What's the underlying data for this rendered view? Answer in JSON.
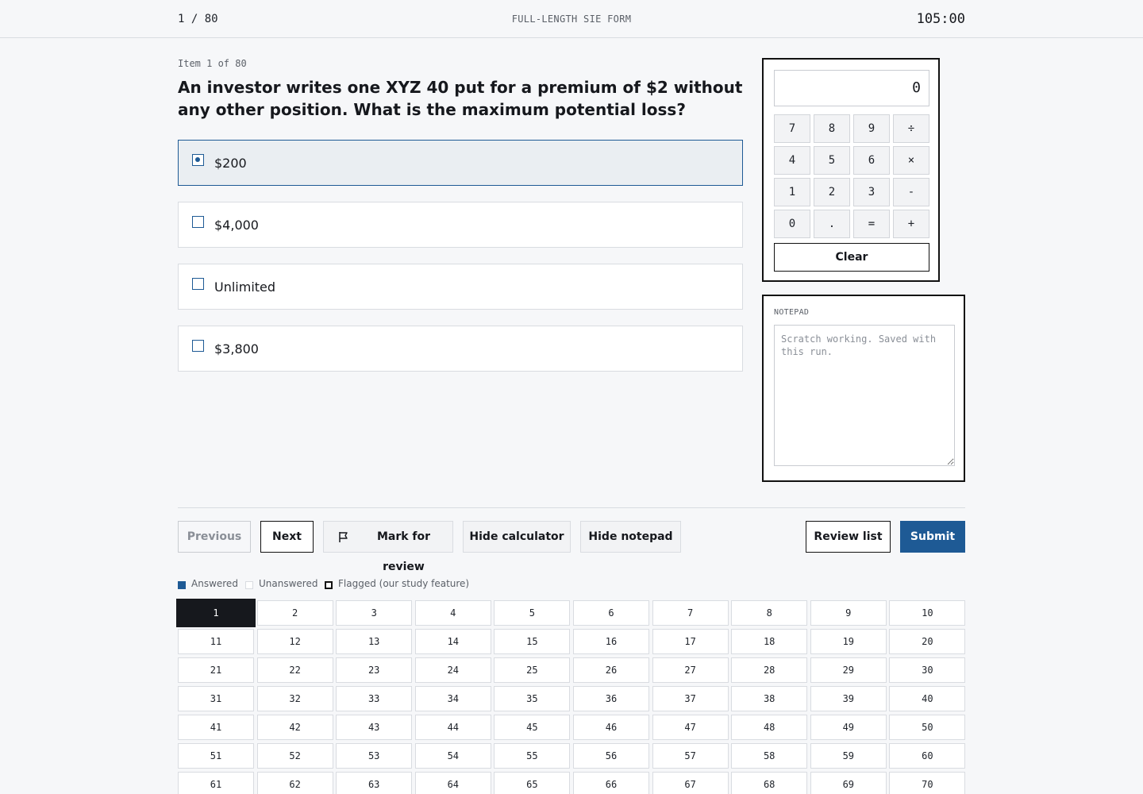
{
  "header": {
    "progress": "1 / 80",
    "form_title": "FULL-LENGTH SIE FORM",
    "timer": "105:00"
  },
  "question": {
    "item_label": "Item 1 of 80",
    "text": "An investor writes one XYZ 40 put for a premium of $2 without any other position. What is the maximum potential loss?",
    "options": [
      {
        "text": "$200",
        "selected": true
      },
      {
        "text": "$4,000",
        "selected": false
      },
      {
        "text": "Unlimited",
        "selected": false
      },
      {
        "text": "$3,800",
        "selected": false
      }
    ]
  },
  "calculator": {
    "display": "0",
    "keys": [
      "7",
      "8",
      "9",
      "÷",
      "4",
      "5",
      "6",
      "×",
      "1",
      "2",
      "3",
      "-",
      "0",
      ".",
      "=",
      "+"
    ],
    "clear_label": "Clear"
  },
  "notepad": {
    "label": "NOTEPAD",
    "placeholder": "Scratch working. Saved with this run.",
    "value": ""
  },
  "actions": {
    "previous": "Previous",
    "next": "Next",
    "mark_for_review": "Mark for review",
    "hide_calculator": "Hide calculator",
    "hide_notepad": "Hide notepad",
    "review_list": "Review list",
    "submit": "Submit"
  },
  "legend": {
    "answered": "Answered",
    "unanswered": "Unanswered",
    "flagged": "Flagged (our study feature)"
  },
  "navigator": {
    "current": 1,
    "visible_items": [
      "1",
      "2",
      "3",
      "4",
      "5",
      "6",
      "7",
      "8",
      "9",
      "10",
      "11",
      "12",
      "13",
      "14",
      "15",
      "16",
      "17",
      "18",
      "19",
      "20",
      "21",
      "22",
      "23",
      "24",
      "25",
      "26",
      "27",
      "28",
      "29",
      "30",
      "31",
      "32",
      "33",
      "34",
      "35",
      "36",
      "37",
      "38",
      "39",
      "40",
      "41",
      "42",
      "43",
      "44",
      "45",
      "46",
      "47",
      "48",
      "49",
      "50",
      "51",
      "52",
      "53",
      "54",
      "55",
      "56",
      "57",
      "58",
      "59",
      "60",
      "61",
      "62",
      "63",
      "64",
      "65",
      "66",
      "67",
      "68",
      "69",
      "70"
    ]
  },
  "colors": {
    "accent": "#1e5a95",
    "current_cell": "#16181d",
    "background": "#f6f7f9"
  }
}
